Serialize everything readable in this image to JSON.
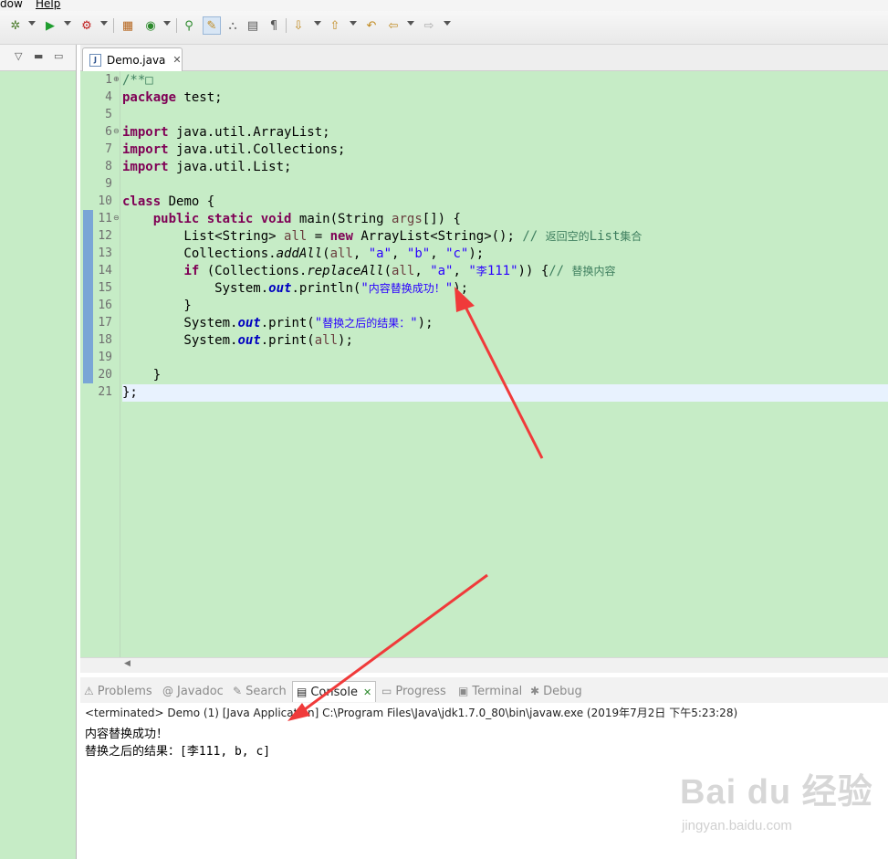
{
  "menu": {
    "item1": "dow",
    "item2": "Help"
  },
  "editor": {
    "tab_label": "Demo.java",
    "lines": [
      {
        "n": "1",
        "fold": "⊕",
        "tokens": [
          {
            "t": "/**",
            "c": "cm"
          },
          {
            "t": "□",
            "c": "cm"
          }
        ]
      },
      {
        "n": "4",
        "tokens": [
          {
            "t": "package",
            "c": "kw"
          },
          {
            "t": " test;",
            "c": ""
          }
        ]
      },
      {
        "n": "5",
        "tokens": []
      },
      {
        "n": "6",
        "fold": "⊖",
        "tokens": [
          {
            "t": "import",
            "c": "kw"
          },
          {
            "t": " java.util.ArrayList;",
            "c": ""
          }
        ]
      },
      {
        "n": "7",
        "tokens": [
          {
            "t": "import",
            "c": "kw"
          },
          {
            "t": " java.util.Collections;",
            "c": ""
          }
        ]
      },
      {
        "n": "8",
        "tokens": [
          {
            "t": "import",
            "c": "kw"
          },
          {
            "t": " java.util.List;",
            "c": ""
          }
        ]
      },
      {
        "n": "9",
        "tokens": []
      },
      {
        "n": "10",
        "tokens": [
          {
            "t": "class",
            "c": "kw"
          },
          {
            "t": " Demo {",
            "c": ""
          }
        ]
      },
      {
        "n": "11",
        "fold": "⊖",
        "tokens": [
          {
            "t": "    ",
            "c": ""
          },
          {
            "t": "public",
            "c": "kw"
          },
          {
            "t": " ",
            "c": ""
          },
          {
            "t": "static",
            "c": "kw"
          },
          {
            "t": " ",
            "c": ""
          },
          {
            "t": "void",
            "c": "kw"
          },
          {
            "t": " main(String ",
            "c": ""
          },
          {
            "t": "args",
            "c": "var"
          },
          {
            "t": "[]) {",
            "c": ""
          }
        ]
      },
      {
        "n": "12",
        "tokens": [
          {
            "t": "        List<String> ",
            "c": ""
          },
          {
            "t": "all",
            "c": "var"
          },
          {
            "t": " = ",
            "c": ""
          },
          {
            "t": "new",
            "c": "kw"
          },
          {
            "t": " ArrayList<String>(); ",
            "c": ""
          },
          {
            "t": "// ",
            "c": "cm"
          },
          {
            "t": "返回空的",
            "c": "cm cjk"
          },
          {
            "t": "List",
            "c": "cm"
          },
          {
            "t": "集合",
            "c": "cm cjk"
          }
        ]
      },
      {
        "n": "13",
        "tokens": [
          {
            "t": "        Collections.",
            "c": ""
          },
          {
            "t": "addAll",
            "c": "it"
          },
          {
            "t": "(",
            "c": ""
          },
          {
            "t": "all",
            "c": "var"
          },
          {
            "t": ", ",
            "c": ""
          },
          {
            "t": "\"a\"",
            "c": "str"
          },
          {
            "t": ", ",
            "c": ""
          },
          {
            "t": "\"b\"",
            "c": "str"
          },
          {
            "t": ", ",
            "c": ""
          },
          {
            "t": "\"c\"",
            "c": "str"
          },
          {
            "t": ");",
            "c": ""
          }
        ]
      },
      {
        "n": "14",
        "tokens": [
          {
            "t": "        ",
            "c": ""
          },
          {
            "t": "if",
            "c": "kw"
          },
          {
            "t": " (Collections.",
            "c": ""
          },
          {
            "t": "replaceAll",
            "c": "it"
          },
          {
            "t": "(",
            "c": ""
          },
          {
            "t": "all",
            "c": "var"
          },
          {
            "t": ", ",
            "c": ""
          },
          {
            "t": "\"a\"",
            "c": "str"
          },
          {
            "t": ", ",
            "c": ""
          },
          {
            "t": "\"",
            "c": "str"
          },
          {
            "t": "李",
            "c": "str cjk"
          },
          {
            "t": "111\"",
            "c": "str"
          },
          {
            "t": ")) {",
            "c": ""
          },
          {
            "t": "// ",
            "c": "cm"
          },
          {
            "t": "替换内容",
            "c": "cm cjk"
          }
        ]
      },
      {
        "n": "15",
        "tokens": [
          {
            "t": "            System.",
            "c": ""
          },
          {
            "t": "out",
            "c": "fld"
          },
          {
            "t": ".println(",
            "c": ""
          },
          {
            "t": "\"",
            "c": "str"
          },
          {
            "t": "内容替换成功！",
            "c": "str cjk"
          },
          {
            "t": "\"",
            "c": "str"
          },
          {
            "t": ");",
            "c": ""
          }
        ]
      },
      {
        "n": "16",
        "tokens": [
          {
            "t": "        }",
            "c": ""
          }
        ]
      },
      {
        "n": "17",
        "tokens": [
          {
            "t": "        System.",
            "c": ""
          },
          {
            "t": "out",
            "c": "fld"
          },
          {
            "t": ".print(",
            "c": ""
          },
          {
            "t": "\"",
            "c": "str"
          },
          {
            "t": "替换之后的结果：",
            "c": "str cjk"
          },
          {
            "t": "\"",
            "c": "str"
          },
          {
            "t": ");",
            "c": ""
          }
        ]
      },
      {
        "n": "18",
        "tokens": [
          {
            "t": "        System.",
            "c": ""
          },
          {
            "t": "out",
            "c": "fld"
          },
          {
            "t": ".print(",
            "c": ""
          },
          {
            "t": "all",
            "c": "var"
          },
          {
            "t": ");",
            "c": ""
          }
        ]
      },
      {
        "n": "19",
        "tokens": []
      },
      {
        "n": "20",
        "tokens": [
          {
            "t": "    }",
            "c": ""
          }
        ]
      },
      {
        "n": "21",
        "current": true,
        "tokens": [
          {
            "t": "};",
            "c": ""
          }
        ]
      }
    ]
  },
  "bottom": {
    "tabs": [
      {
        "label": "Problems",
        "icon": "⚠"
      },
      {
        "label": "Javadoc",
        "icon": "@"
      },
      {
        "label": "Search",
        "icon": "✎"
      },
      {
        "label": "Console",
        "icon": "▤",
        "active": true
      },
      {
        "label": "Progress",
        "icon": "▭"
      },
      {
        "label": "Terminal",
        "icon": "▣"
      },
      {
        "label": "Debug",
        "icon": "✱"
      }
    ],
    "console_header": "<terminated> Demo (1) [Java Application] C:\\Program Files\\Java\\jdk1.7.0_80\\bin\\javaw.exe (2019年7月2日 下午5:23:28)",
    "output_line1": "内容替换成功！",
    "output_line2_prefix": "替换之后的结果：",
    "output_line2_value": "[李111, b, c]"
  },
  "watermark": {
    "logo": "Bai du 经验",
    "url": "jingyan.baidu.com"
  },
  "colors": {
    "editor_bg": "#c6ecc6",
    "arrow": "#f03a3a",
    "keyword": "#7f0055",
    "string": "#2a00ff",
    "comment": "#3f7f5f"
  }
}
